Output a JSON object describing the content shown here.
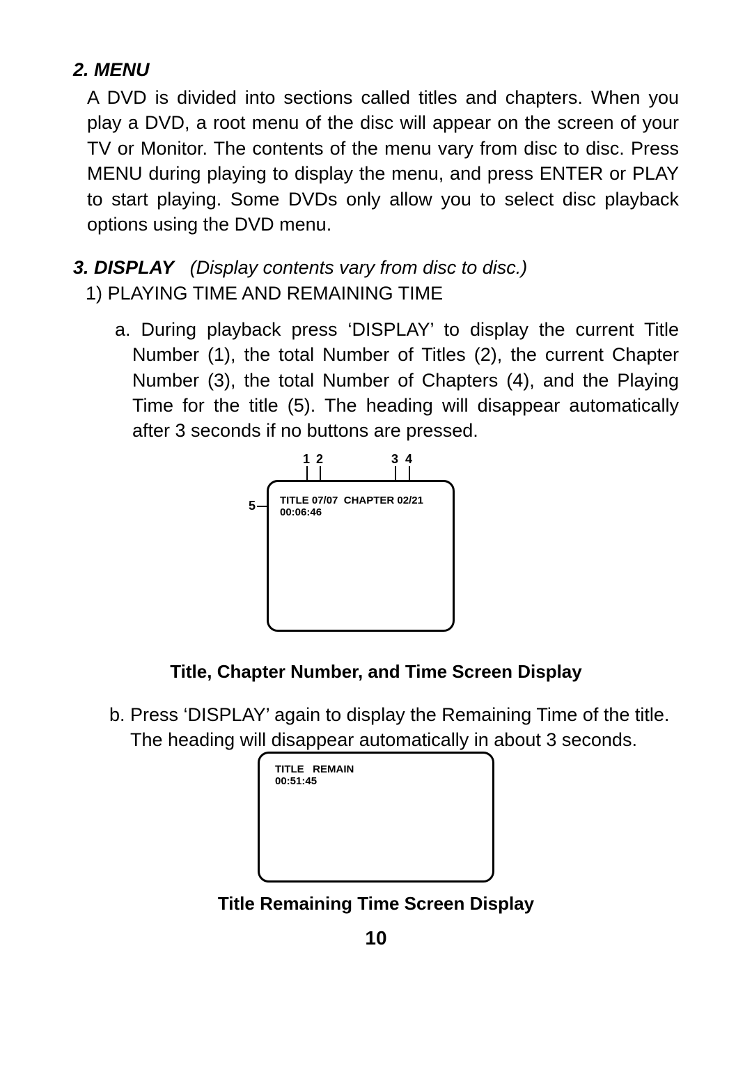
{
  "section2": {
    "heading_number": "2.",
    "heading_label": "MENU",
    "body": "A DVD is divided into sections called titles and chapters.  When you play a DVD, a root menu of the disc will appear on the screen of your TV or Monitor. The contents of the menu vary from disc to disc. Press MENU during playing to display the menu, and press ENTER or PLAY to start playing. Some DVDs only allow you to select disc playback options using the DVD menu."
  },
  "section3": {
    "heading_number": "3.",
    "heading_label": "DISPLAY",
    "heading_note": "(Display contents vary from disc to disc.)",
    "sub1_label": "1)  PLAYING TIME AND REMAINING TIME",
    "item_a_text": "a. During playback press ‘DISPLAY’ to display the current  Title Number (1), the total Number of Titles (2), the current Chapter Number (3), the total Number of Chapters (4), and the Playing Time for the title (5). The heading will disappear automatically after 3 seconds if no buttons are pressed.",
    "item_b_text": "b. Press ‘DISPLAY’ again to display the Remaining Time of  the title.  The heading will disappear automatically  in about 3 seconds."
  },
  "figure1": {
    "callouts": {
      "c1": "1",
      "c2": "2",
      "c3": "3",
      "c4": "4",
      "c5": "5"
    },
    "osd_line1_left": "TITLE",
    "osd_title_current": "07",
    "osd_title_sep": "/",
    "osd_title_total": "07",
    "osd_line1_mid": "CHAPTER",
    "osd_chapter_current": "02",
    "osd_chapter_sep": "/",
    "osd_chapter_total": "21",
    "osd_line2_time": "00:06:46",
    "caption": "Title, Chapter Number, and Time Screen Display"
  },
  "figure2": {
    "osd_line1": "TITLE   REMAIN",
    "osd_line2": "00:51:45",
    "caption": "Title Remaining Time Screen Display"
  },
  "page_number": "10"
}
